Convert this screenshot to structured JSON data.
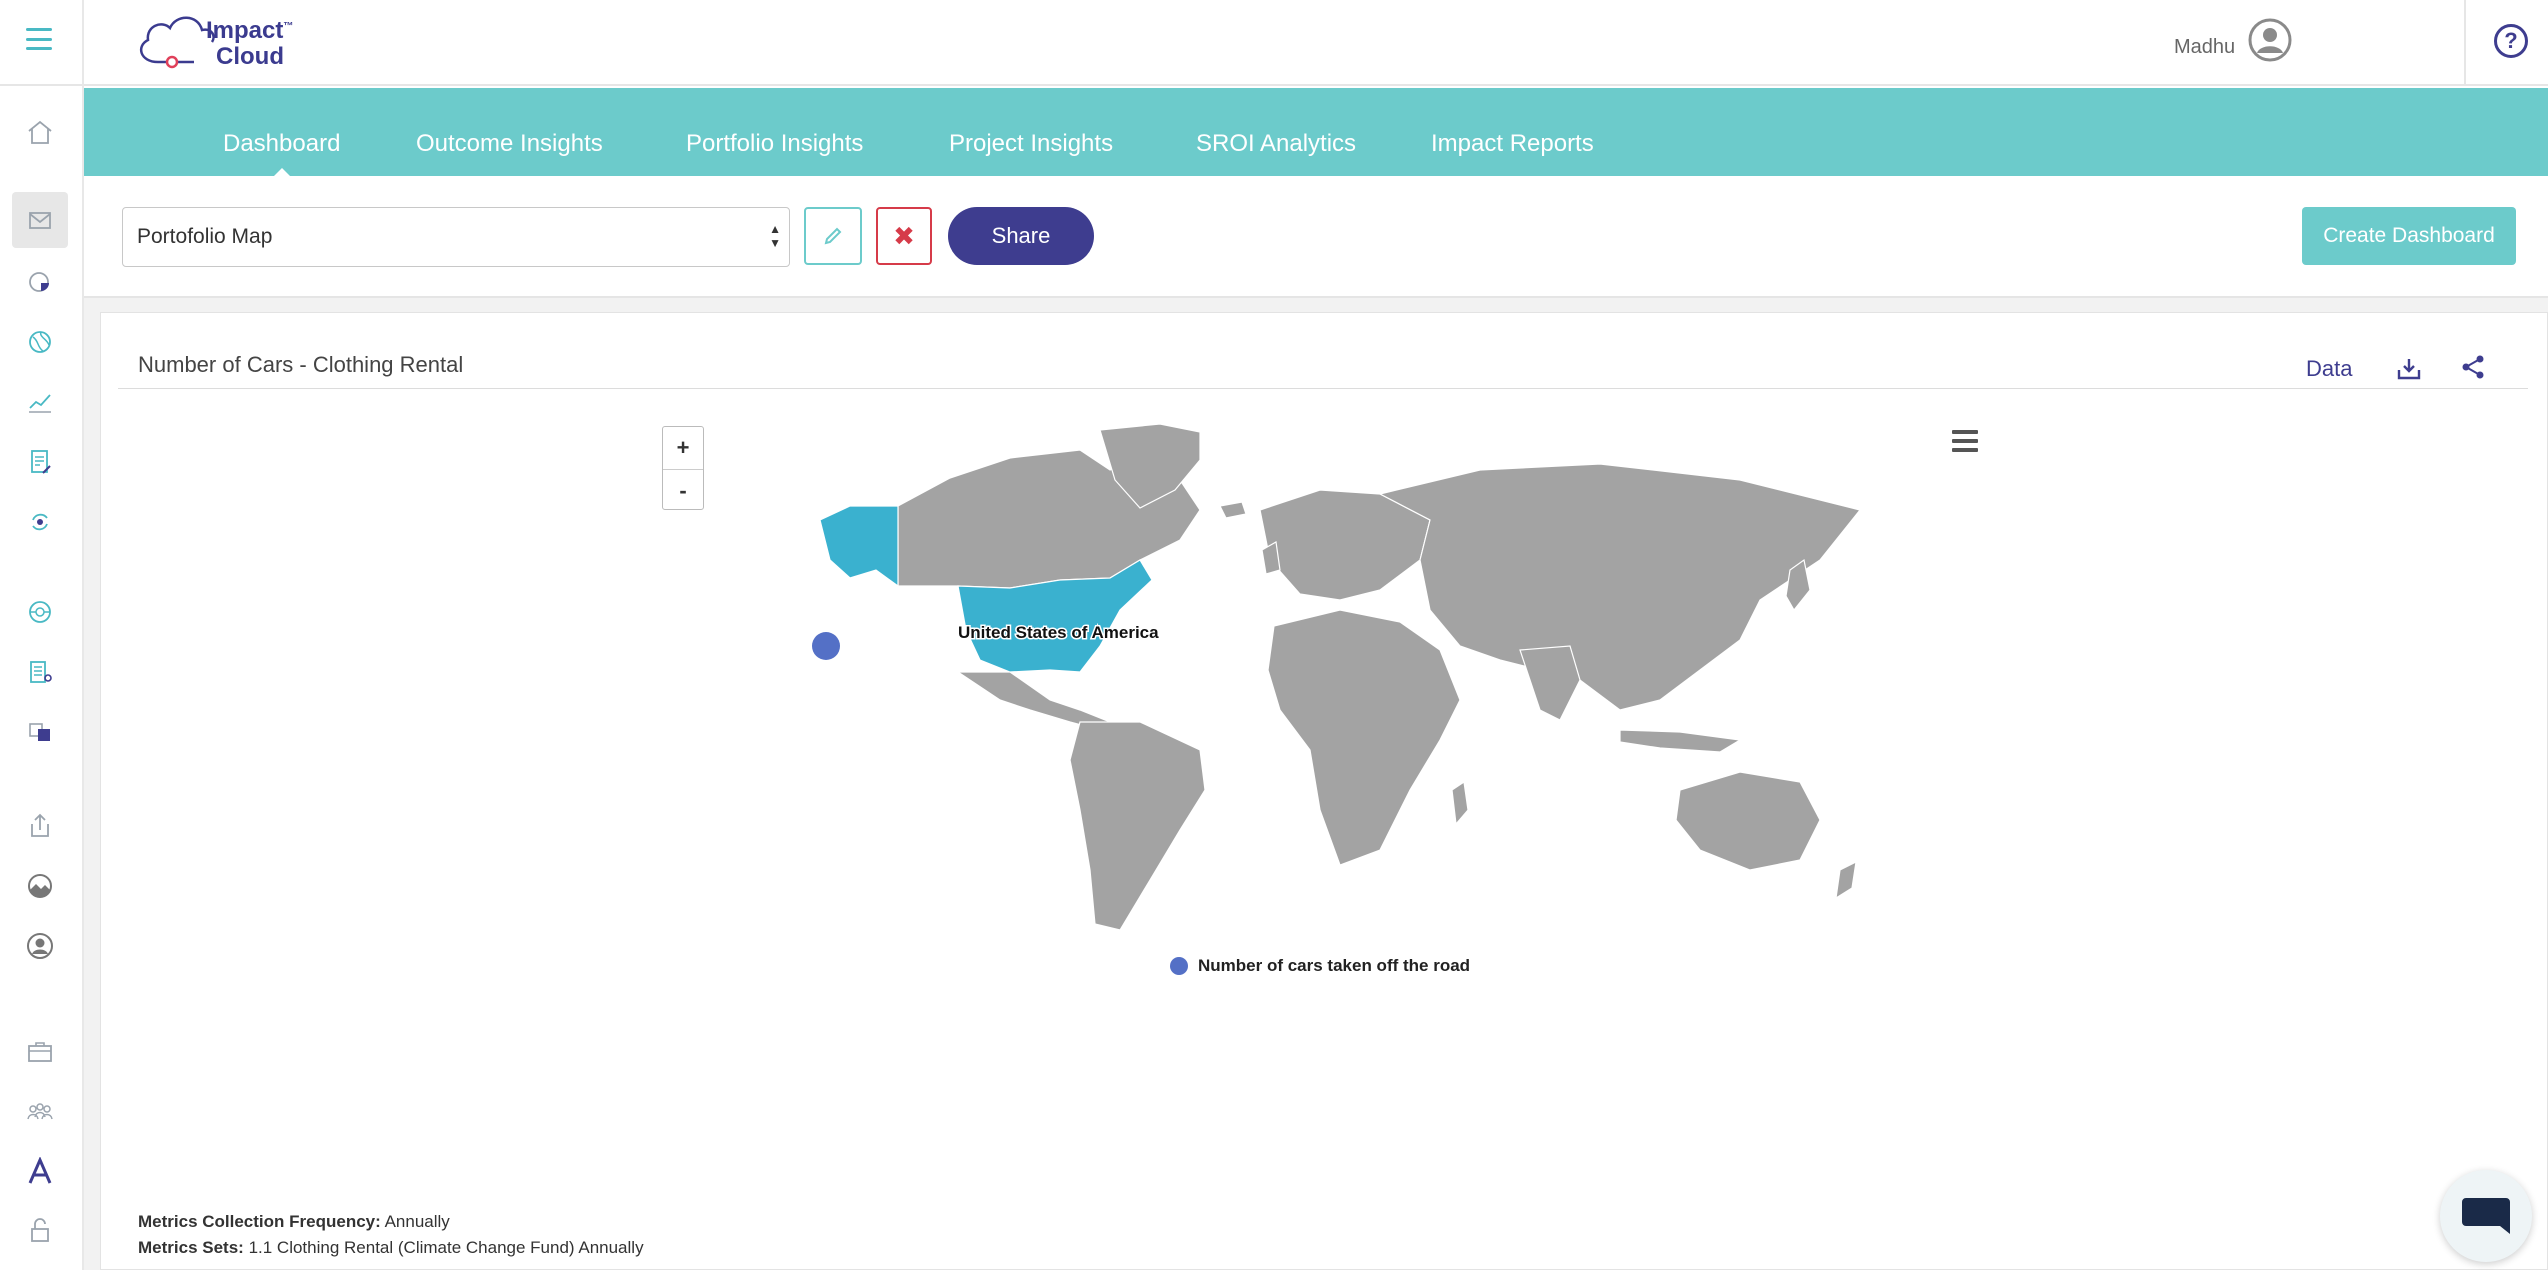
{
  "header": {
    "logo_line1": "Impact",
    "logo_tm": "™",
    "logo_line2": "Cloud",
    "user_name": "Madhu",
    "help_symbol": "?"
  },
  "nav": {
    "tabs": [
      {
        "label": "Dashboard",
        "active": true
      },
      {
        "label": "Outcome Insights"
      },
      {
        "label": "Portfolio Insights"
      },
      {
        "label": "Project Insights"
      },
      {
        "label": "SROI Analytics"
      },
      {
        "label": "Impact Reports"
      }
    ]
  },
  "toolbar": {
    "dashboard_select_value": "Portofolio Map",
    "close_symbol": "✖",
    "share_label": "Share",
    "create_label": "Create Dashboard"
  },
  "panel": {
    "title": "Number of Cars - Clothing Rental",
    "data_label": "Data",
    "zoom_in": "+",
    "zoom_out": "-",
    "country_label": "United States of America",
    "legend_label": "Number of cars taken off the road"
  },
  "meta": {
    "freq_label": "Metrics Collection Frequency:",
    "freq_value": "Annually",
    "sets_label": "Metrics Sets:",
    "sets_value": "1.1 Clothing Rental (Climate Change Fund) Annually"
  },
  "colors": {
    "teal": "#6ccbcb",
    "navy": "#3e3d8f",
    "highlight_country": "#3ab1cf",
    "land": "#a3a3a3",
    "marker": "#5470c6",
    "danger": "#d63b49"
  },
  "icons": {
    "sidebar": [
      "home-icon",
      "inbox-icon",
      "pie-chart-icon",
      "globe-icon",
      "line-chart-icon",
      "report-edit-icon",
      "cycle-icon",
      "network-icon",
      "document-icon",
      "translate-icon",
      "upload-icon",
      "landscape-icon",
      "user-circle-icon",
      "briefcase-icon",
      "team-icon",
      "font-icon",
      "lock-icon"
    ]
  }
}
